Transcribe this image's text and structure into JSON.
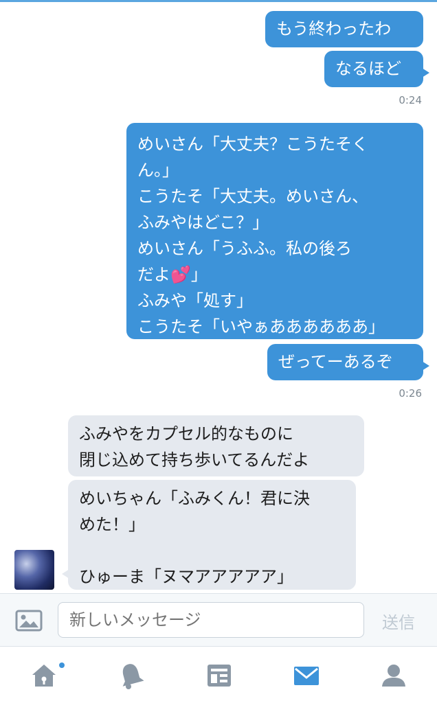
{
  "messages": {
    "m1": "もう終わったわ",
    "m2": "なるほど",
    "t1": "0:24",
    "m3": "めいさん「大丈夫？こうたそく\nん。」\nこうたそ「大丈夫。めいさん、\nふみやはどこ？」\nめいさん「うふふ。私の後ろ\nだよ💕」\nふみや「処す」\nこうたそ「いやぁああああああ」",
    "m4": "ぜってーあるぞ",
    "t2": "0:26",
    "m5": "ふみやをカプセル的なものに\n閉じ込めて持ち歩いてるんだよ",
    "m6": "めいちゃん「ふみくん！君に決\nめた！」\n\nひゅーま「ヌマアアアアア」"
  },
  "composer": {
    "placeholder": "新しいメッセージ",
    "send_label": "送信"
  },
  "tabs": [
    "home-icon",
    "notifications-icon",
    "moments-icon",
    "messages-icon",
    "profile-icon"
  ],
  "colors": {
    "accent": "#3d93d9",
    "incoming_bubble": "#e5e9ef",
    "inactive_icon": "#8b98a5"
  }
}
